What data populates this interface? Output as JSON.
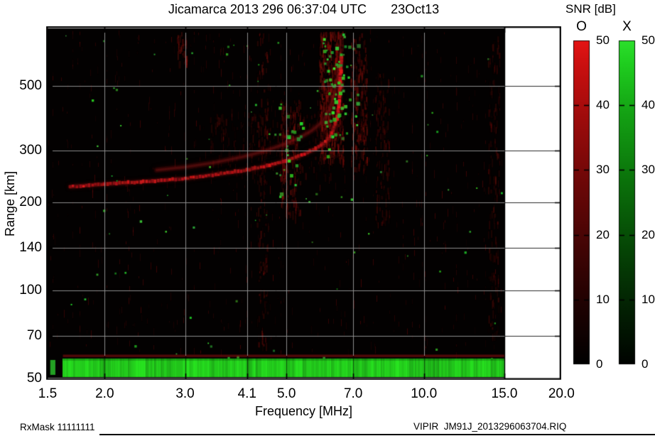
{
  "header": {
    "title": "Jicamarca 2013 296 06:37:04 UTC",
    "date": "23Oct13",
    "colorbar_title": "SNR [dB]"
  },
  "axes": {
    "x": {
      "label": "Frequency [MHz]",
      "scale": "log",
      "ticks": [
        {
          "v": 1.5,
          "label": "1.5"
        },
        {
          "v": 2.0,
          "label": "2.0"
        },
        {
          "v": 3.0,
          "label": "3.0"
        },
        {
          "v": 4.1,
          "label": "4.1"
        },
        {
          "v": 5.0,
          "label": "5.0"
        },
        {
          "v": 7.0,
          "label": "7.0"
        },
        {
          "v": 10.0,
          "label": "10.0"
        },
        {
          "v": 15.0,
          "label": "15.0"
        },
        {
          "v": 20.0,
          "label": "20.0"
        }
      ]
    },
    "y": {
      "label": "Range [km]",
      "scale": "log",
      "ticks": [
        {
          "v": 50,
          "label": "50"
        },
        {
          "v": 70,
          "label": "70"
        },
        {
          "v": 100,
          "label": "100"
        },
        {
          "v": 140,
          "label": "140"
        },
        {
          "v": 200,
          "label": "200"
        },
        {
          "v": 300,
          "label": "300"
        },
        {
          "v": 500,
          "label": "500"
        }
      ]
    }
  },
  "colorbars": {
    "title": "SNR [dB]",
    "min": 0,
    "max": 50,
    "o": {
      "label": "O",
      "stops": [
        [
          0,
          "#000000"
        ],
        [
          0.18,
          "#1e0202"
        ],
        [
          0.38,
          "#460505"
        ],
        [
          0.58,
          "#710808"
        ],
        [
          0.78,
          "#a30c0c"
        ],
        [
          0.93,
          "#cc1010"
        ],
        [
          1,
          "#e51414"
        ]
      ]
    },
    "x": {
      "label": "X",
      "stops": [
        [
          0,
          "#000300"
        ],
        [
          0.18,
          "#032203"
        ],
        [
          0.38,
          "#064a06"
        ],
        [
          0.58,
          "#0b750b"
        ],
        [
          0.78,
          "#14a314"
        ],
        [
          0.93,
          "#1fce1f"
        ],
        [
          1,
          "#2ce02c"
        ]
      ]
    },
    "tick_labels": [
      {
        "v": 0,
        "label": "0"
      },
      {
        "v": 10,
        "label": "10"
      },
      {
        "v": 20,
        "label": "20"
      },
      {
        "v": 30,
        "label": "30"
      },
      {
        "v": 40,
        "label": "40"
      },
      {
        "v": 50,
        "label": "50"
      }
    ],
    "dash_ticks": [
      10,
      20,
      30,
      40
    ]
  },
  "footer": {
    "left": "RxMask 11111111",
    "right": "VIPIR  JM91J_2013296063704.RIQ"
  },
  "chart_data": {
    "type": "heatmap",
    "title": "Jicamarca 2013 296 06:37:04 UTC",
    "date_label": "23Oct13",
    "xlabel": "Frequency [MHz]",
    "ylabel": "Range [km]",
    "x_scale": "log",
    "y_scale": "log",
    "xlim": [
      1.5,
      20.0
    ],
    "ylim": [
      50,
      780
    ],
    "x_ticks": [
      1.5,
      2.0,
      3.0,
      4.1,
      5.0,
      7.0,
      10.0,
      15.0,
      20.0
    ],
    "y_ticks": [
      50,
      70,
      100,
      140,
      200,
      300,
      500
    ],
    "data_freq_max": 15.0,
    "grid": true,
    "background": "#030101",
    "colorbar": {
      "label": "SNR [dB]",
      "min": 0,
      "max": 50,
      "modes": [
        "O",
        "X"
      ]
    },
    "foF2_MHz": 6.55,
    "o_trace": {
      "name": "O-mode F-region echo trace (red)",
      "points_freq_km": [
        [
          1.68,
          226
        ],
        [
          1.8,
          228
        ],
        [
          2.0,
          231
        ],
        [
          2.4,
          235
        ],
        [
          3.0,
          241
        ],
        [
          3.5,
          249
        ],
        [
          4.1,
          258
        ],
        [
          4.6,
          268
        ],
        [
          5.0,
          278
        ],
        [
          5.4,
          290
        ],
        [
          5.8,
          305
        ],
        [
          6.1,
          322
        ],
        [
          6.3,
          345
        ],
        [
          6.45,
          385
        ],
        [
          6.52,
          435
        ],
        [
          6.55,
          495
        ],
        [
          6.57,
          560
        ],
        [
          6.58,
          630
        ]
      ]
    },
    "o_trace_upper": {
      "name": "diffuse second echo / spread F (faint red)",
      "points_freq_km": [
        [
          2.6,
          258
        ],
        [
          3.0,
          264
        ],
        [
          3.5,
          274
        ],
        [
          4.0,
          286
        ],
        [
          4.5,
          300
        ],
        [
          5.0,
          318
        ],
        [
          5.4,
          336
        ],
        [
          5.7,
          353
        ],
        [
          6.0,
          378
        ],
        [
          6.2,
          412
        ],
        [
          6.35,
          465
        ],
        [
          6.45,
          525
        ],
        [
          6.5,
          585
        ]
      ]
    },
    "x_echo_clusters": [
      {
        "name": "X-mode echoes",
        "f": [
          4.75,
          5.45
        ],
        "km": [
          190,
          440
        ],
        "count": 22
      },
      {
        "name": "X-mode echoes dense near foF2",
        "f": [
          6.0,
          6.7
        ],
        "km": [
          290,
          760
        ],
        "count": 60
      },
      {
        "name": "X-mode echoes",
        "f": [
          6.7,
          7.15
        ],
        "km": [
          300,
          700
        ],
        "count": 12
      }
    ],
    "sparse_green": {
      "count": 85,
      "f": [
        1.55,
        14.8
      ],
      "km": [
        52,
        760
      ]
    },
    "noise_regions": [
      {
        "f": [
          2.88,
          3.02
        ],
        "km": [
          600,
          770
        ],
        "density": 0.06,
        "alpha": 1.0
      },
      {
        "f": [
          4.3,
          4.55
        ],
        "km": [
          65,
          760
        ],
        "density": 0.02,
        "alpha": 0.8
      },
      {
        "f": [
          4.85,
          5.35
        ],
        "km": [
          180,
          450
        ],
        "density": 0.05,
        "alpha": 0.9
      },
      {
        "f": [
          3.4,
          6.3
        ],
        "km": [
          250,
          420
        ],
        "density": 0.015,
        "alpha": 0.5
      },
      {
        "f": [
          5.9,
          6.65
        ],
        "km": [
          280,
          770
        ],
        "density": 0.09,
        "alpha": 1.0
      },
      {
        "f": [
          6.9,
          7.5
        ],
        "km": [
          260,
          760
        ],
        "density": 0.05,
        "alpha": 0.85
      },
      {
        "f": [
          7.8,
          8.4
        ],
        "km": [
          170,
          560
        ],
        "density": 0.03,
        "alpha": 0.6
      },
      {
        "f": [
          13.8,
          14.6
        ],
        "km": [
          70,
          760
        ],
        "density": 0.02,
        "alpha": 0.6
      }
    ],
    "ground_band": {
      "name": "near-range noise band (bright X/green)",
      "f": [
        1.62,
        15.0
      ],
      "km": [
        50,
        58.5
      ],
      "top_edge_red_km": 60,
      "sliver_f": [
        1.52,
        1.56
      ]
    }
  }
}
